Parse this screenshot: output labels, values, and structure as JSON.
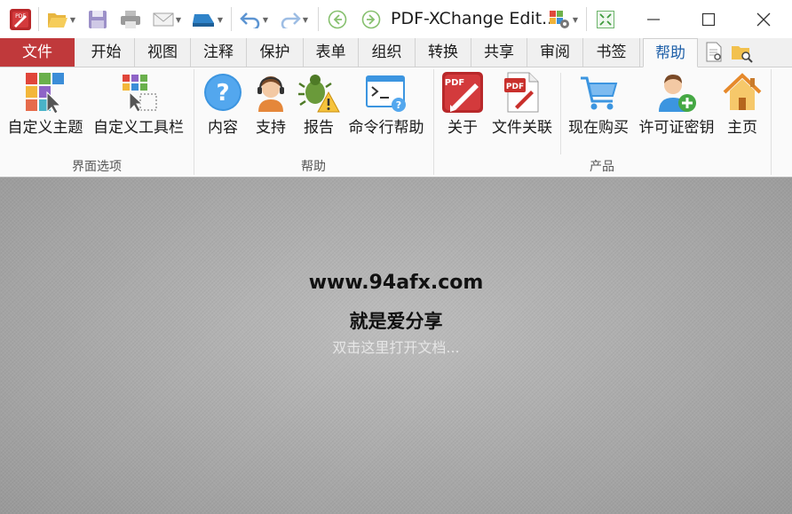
{
  "titlebar": {
    "title": "PDF-XChange Edit..",
    "app_icon_text": "PDF"
  },
  "tabs": [
    {
      "label": "文件"
    },
    {
      "label": "开始"
    },
    {
      "label": "视图"
    },
    {
      "label": "注释"
    },
    {
      "label": "保护"
    },
    {
      "label": "表单"
    },
    {
      "label": "组织"
    },
    {
      "label": "转换"
    },
    {
      "label": "共享"
    },
    {
      "label": "审阅"
    },
    {
      "label": "书签"
    },
    {
      "label": "帮助"
    }
  ],
  "active_tab": "帮助",
  "ribbon": {
    "groups": [
      {
        "label": "界面选项"
      },
      {
        "label": "帮助"
      },
      {
        "label": "产品"
      }
    ],
    "buttons": [
      {
        "label": "自定义主题",
        "icon": "theme-tiles-icon"
      },
      {
        "label": "自定义工具栏",
        "icon": "toolbar-customize-icon"
      },
      {
        "label": "内容",
        "icon": "help-question-icon"
      },
      {
        "label": "支持",
        "icon": "support-headset-icon"
      },
      {
        "label": "报告",
        "icon": "bug-warning-icon"
      },
      {
        "label": "命令行帮助",
        "icon": "command-line-icon"
      },
      {
        "label": "关于",
        "icon": "pdf-logo-icon"
      },
      {
        "label": "文件关联",
        "icon": "file-association-icon"
      },
      {
        "label": "现在购买",
        "icon": "shopping-cart-icon"
      },
      {
        "label": "许可证密钥",
        "icon": "user-add-icon"
      },
      {
        "label": "主页",
        "icon": "home-icon"
      }
    ]
  },
  "document": {
    "watermark_url": "www.94afx.com",
    "watermark_slogan": "就是爱分享",
    "open_hint": "双击这里打开文档..."
  },
  "colors": {
    "file_tab": "#c0393b",
    "active_tab_text": "#1d5fa8",
    "ribbon_bg": "#fafafa",
    "doc_bg": "#a9a9a9"
  }
}
